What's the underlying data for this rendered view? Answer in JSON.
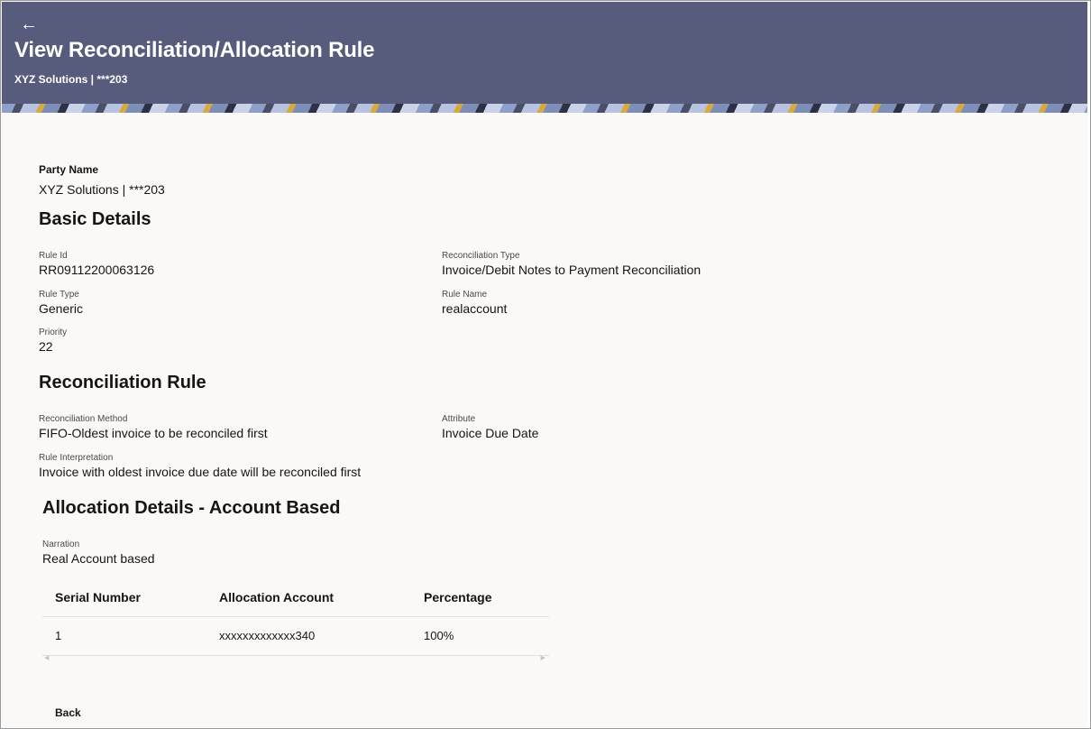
{
  "header": {
    "back_icon": "arrow-left-icon",
    "title": "View Reconciliation/Allocation Rule",
    "subtitle": "XYZ Solutions | ***203",
    "color": "#585c7c"
  },
  "party": {
    "label": "Party Name",
    "value": "XYZ Solutions | ***203"
  },
  "basic_details": {
    "title": "Basic Details",
    "rule_id_label": "Rule Id",
    "rule_id": "RR09112200063126",
    "reconciliation_type_label": "Reconciliation Type",
    "reconciliation_type": "Invoice/Debit Notes to Payment Reconciliation",
    "rule_type_label": "Rule Type",
    "rule_type": "Generic",
    "rule_name_label": "Rule Name",
    "rule_name": "realaccount",
    "priority_label": "Priority",
    "priority": "22"
  },
  "reconciliation_rule": {
    "title": "Reconciliation Rule",
    "method_label": "Reconciliation Method",
    "method": "FIFO-Oldest invoice to be reconciled first",
    "attribute_label": "Attribute",
    "attribute": "Invoice Due Date",
    "interpretation_label": "Rule Interpretation",
    "interpretation": "Invoice with oldest invoice due date will be reconciled first"
  },
  "allocation": {
    "title": "Allocation Details - Account Based",
    "narration_label": "Narration",
    "narration": "Real Account based",
    "columns": [
      "Serial Number",
      "Allocation Account",
      "Percentage"
    ],
    "rows": [
      [
        "1",
        "xxxxxxxxxxxxx340",
        "100%"
      ]
    ]
  },
  "actions": {
    "back_label": "Back"
  }
}
